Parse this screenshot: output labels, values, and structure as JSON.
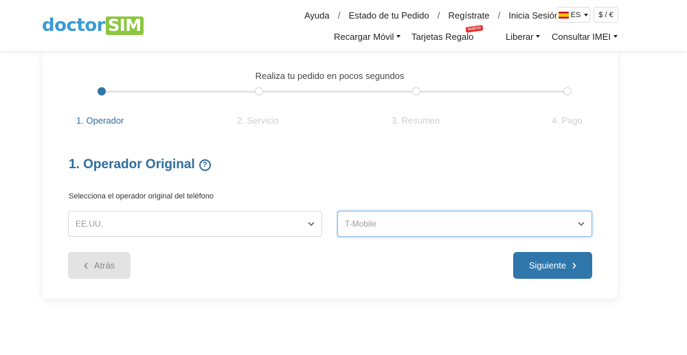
{
  "logo": {
    "part1": "doctor",
    "part2": "SIM"
  },
  "topnav": [
    {
      "label": "Ayuda"
    },
    {
      "label": "Estado de tu Pedido"
    },
    {
      "label": "Regístrate"
    },
    {
      "label": "Inicia Sesión"
    }
  ],
  "separator": "/",
  "language": {
    "code": "ES"
  },
  "currency": {
    "label": "$ / €"
  },
  "mainnav": {
    "recargar": "Recargar Móvil",
    "tarjetas": "Tarjetas Regalo",
    "nuevo_badge": "NUEVO",
    "liberar": "Liberar",
    "consultar": "Consultar IMEI"
  },
  "stepper": {
    "title": "Realiza tu pedido en pocos segundos",
    "steps": [
      "1. Operador",
      "2. Servicio",
      "3. Resumen",
      "4. Pago"
    ],
    "active_index": 0
  },
  "form": {
    "section_title": "1. Operador Original",
    "select_label": "Selecciona el operador original del teléfono",
    "country_value": "EE.UU.",
    "carrier_value": "T-Mobile"
  },
  "buttons": {
    "back": "Atrás",
    "next": "Siguiente"
  },
  "colors": {
    "primary": "#2f76ab",
    "logo_blue": "#3a9bd5",
    "logo_green": "#8cc63f"
  }
}
